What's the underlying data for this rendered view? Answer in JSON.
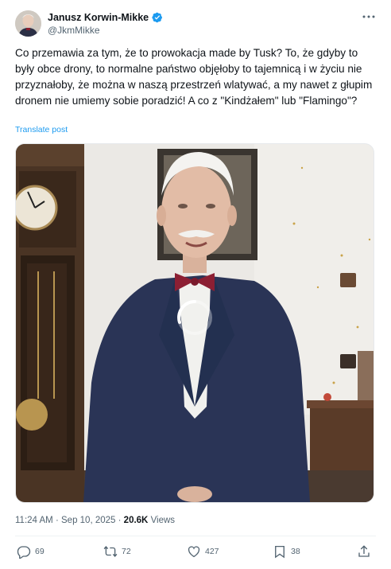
{
  "author": {
    "display_name": "Janusz Korwin-Mikke",
    "handle": "@JkmMikke",
    "verified": true
  },
  "tweet": {
    "text": "Co przemawia za tym, że to prowokacja made by Tusk? To, że gdyby to były obce drony, to normalne państwo objęłoby to tajemnicą i w życiu nie przyznałoby, że można w naszą przestrzeń wlatywać, a my nawet z głupim dronem nie umiemy sobie poradzić! A co z \"Kindżałem\" lub \"Flamingo\"?",
    "translate_label": "Translate post",
    "time": "11:24 AM",
    "date": "Sep 10, 2025",
    "separator": "·",
    "views_count": "20.6K",
    "views_label": "Views"
  },
  "media": {
    "type": "video",
    "state": "loading"
  },
  "actions": {
    "replies": "69",
    "reposts": "72",
    "likes": "427",
    "bookmarks": "38"
  },
  "icons": {
    "verified": "verified-badge-icon",
    "more": "more-dots-icon",
    "reply": "reply-icon",
    "repost": "repost-icon",
    "like": "heart-icon",
    "bookmark": "bookmark-icon",
    "share": "share-icon"
  },
  "colors": {
    "accent": "#1d9bf0",
    "text": "#0f1419",
    "secondary": "#536471"
  }
}
